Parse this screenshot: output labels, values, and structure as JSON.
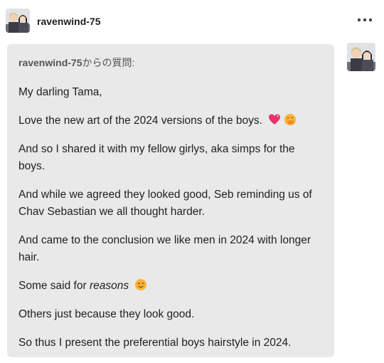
{
  "post": {
    "username": "ravenwind-75",
    "more_label": "•••"
  },
  "ask": {
    "asker": "ravenwind-75",
    "asked_suffix": "からの質問:",
    "paragraphs": {
      "p1": "My darling Tama,",
      "p2": "Love the new art of the 2024 versions of the boys.",
      "p3": "And so I shared it with my fellow girlys, aka simps for the boys.",
      "p4": "And while we agreed they looked good, Seb reminding us of Chav Sebastian we all thought harder.",
      "p5": "And came to the conclusion we like men in 2024 with longer hair.",
      "p6_before": "Some said for ",
      "p6_em": "reasons",
      "p7": "Others just because they look good.",
      "p8": "So thus I present the preferential boys hairstyle in 2024."
    }
  },
  "icons": {
    "more": "more-dots-icon",
    "heart": "sparkling-heart-icon",
    "hand_over_mouth": "face-hand-over-mouth-icon",
    "wink": "winking-face-icon"
  },
  "colors": {
    "ask_background": "#e9e9e9",
    "text": "#1f1f1f",
    "muted": "#555555",
    "heart": "#e8336d",
    "emoji_yellow": "#f5b43a"
  }
}
